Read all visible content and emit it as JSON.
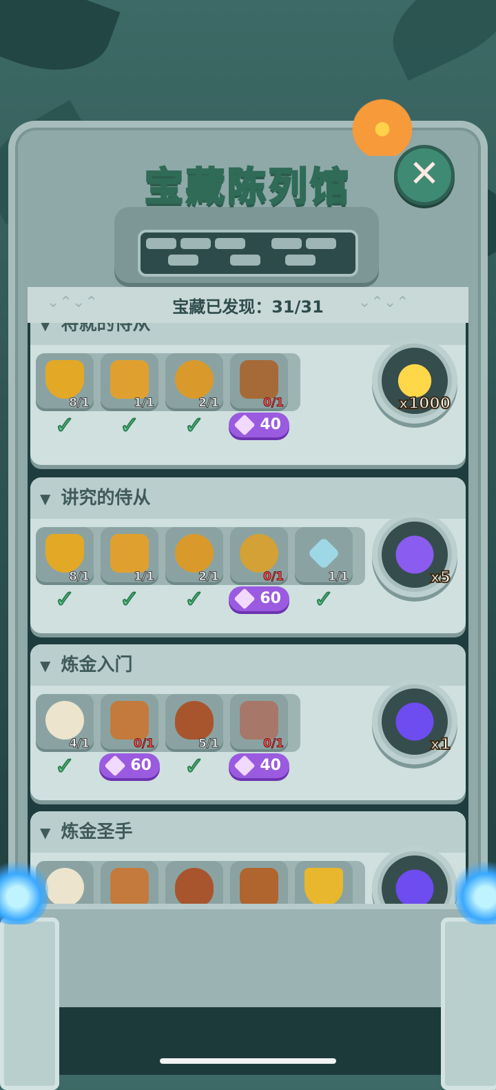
{
  "title": "宝藏陈列馆",
  "counter": "宝藏已发现：31/31",
  "close_icon": "close-icon",
  "colors": {
    "gem": "#9b5be0",
    "check": "#5fd58d",
    "zero_count": "#ff4f4f"
  },
  "cards": [
    {
      "header": "将就的侍从",
      "items": [
        {
          "icon": "shield-icon",
          "count": "8/1",
          "status": "check"
        },
        {
          "icon": "armor-icon",
          "count": "1/1",
          "status": "check"
        },
        {
          "icon": "belt-icon",
          "count": "2/1",
          "status": "check"
        },
        {
          "icon": "boots-icon",
          "count": "0/1",
          "status": "gem",
          "gem_cost": "40"
        }
      ],
      "reward": {
        "icon": "gold-coins-icon",
        "label": "x1000"
      }
    },
    {
      "header": "讲究的侍从",
      "items": [
        {
          "icon": "shield-icon",
          "count": "8/1",
          "status": "check"
        },
        {
          "icon": "armor-icon",
          "count": "1/1",
          "status": "check"
        },
        {
          "icon": "belt-icon",
          "count": "2/1",
          "status": "check"
        },
        {
          "icon": "medallion-icon",
          "count": "0/1",
          "status": "gem",
          "gem_cost": "60"
        },
        {
          "icon": "sword-icon",
          "count": "1/1",
          "status": "check"
        }
      ],
      "reward": {
        "icon": "mystery-ticket-icon",
        "label": "x5"
      }
    },
    {
      "header": "炼金入门",
      "items": [
        {
          "icon": "bone-ring-icon",
          "count": "4/1",
          "status": "check"
        },
        {
          "icon": "totem-icon",
          "count": "0/1",
          "status": "gem",
          "gem_cost": "60"
        },
        {
          "icon": "tribal-mask-icon",
          "count": "5/1",
          "status": "check"
        },
        {
          "icon": "stone-tablet-icon",
          "count": "0/1",
          "status": "gem",
          "gem_cost": "40"
        }
      ],
      "reward": {
        "icon": "ticket-icon",
        "label": "x1"
      }
    },
    {
      "header": "炼金圣手",
      "items": [
        {
          "icon": "bone-ring-icon"
        },
        {
          "icon": "totem-icon"
        },
        {
          "icon": "tribal-mask-icon"
        },
        {
          "icon": "book-icon"
        },
        {
          "icon": "golden-bowl-icon"
        }
      ],
      "reward": {
        "icon": "tickets-icon"
      }
    }
  ]
}
